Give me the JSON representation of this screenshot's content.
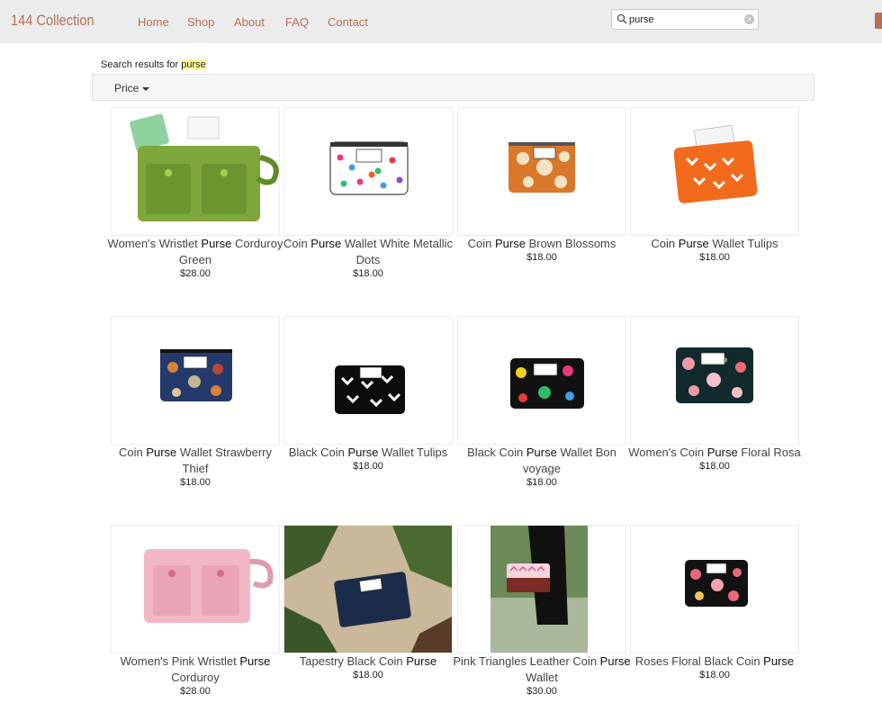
{
  "header": {
    "brand": "144 Collection",
    "nav": [
      "Home",
      "Shop",
      "About",
      "FAQ",
      "Contact"
    ],
    "search_value": "purse"
  },
  "results": {
    "prefix": "Search results for ",
    "query": "purse",
    "filter_label": "Price"
  },
  "products": [
    {
      "pre": "Women's Wristlet ",
      "hit": "Purse",
      "post": " Corduroy Green",
      "price": "$28.00"
    },
    {
      "pre": "Coin ",
      "hit": "Purse",
      "post": " Wallet White Metallic Dots",
      "price": "$18.00"
    },
    {
      "pre": "Coin ",
      "hit": "Purse",
      "post": " Brown Blossoms",
      "price": "$18.00"
    },
    {
      "pre": "Coin ",
      "hit": "Purse",
      "post": " Wallet Tulips",
      "price": "$18.00"
    },
    {
      "pre": "Coin ",
      "hit": "Purse",
      "post": " Wallet Strawberry Thief",
      "price": "$18.00"
    },
    {
      "pre": "Black Coin ",
      "hit": "Purse",
      "post": " Wallet Tulips",
      "price": "$18.00"
    },
    {
      "pre": "Black Coin ",
      "hit": "Purse",
      "post": " Wallet Bon voyage",
      "price": "$18.00"
    },
    {
      "pre": "Women's Coin ",
      "hit": "Purse",
      "post": " Floral Rosa",
      "price": "$18.00"
    },
    {
      "pre": "Women's Pink Wristlet ",
      "hit": "Purse",
      "post": " Corduroy",
      "price": "$28.00"
    },
    {
      "pre": "Tapestry Black Coin ",
      "hit": "Purse",
      "post": "",
      "price": "$18.00"
    },
    {
      "pre": "Pink Triangles Leather Coin ",
      "hit": "Purse",
      "post": " Wallet",
      "price": "$30.00"
    },
    {
      "pre": "Roses Floral Black Coin ",
      "hit": "Purse",
      "post": "",
      "price": "$18.00"
    }
  ]
}
